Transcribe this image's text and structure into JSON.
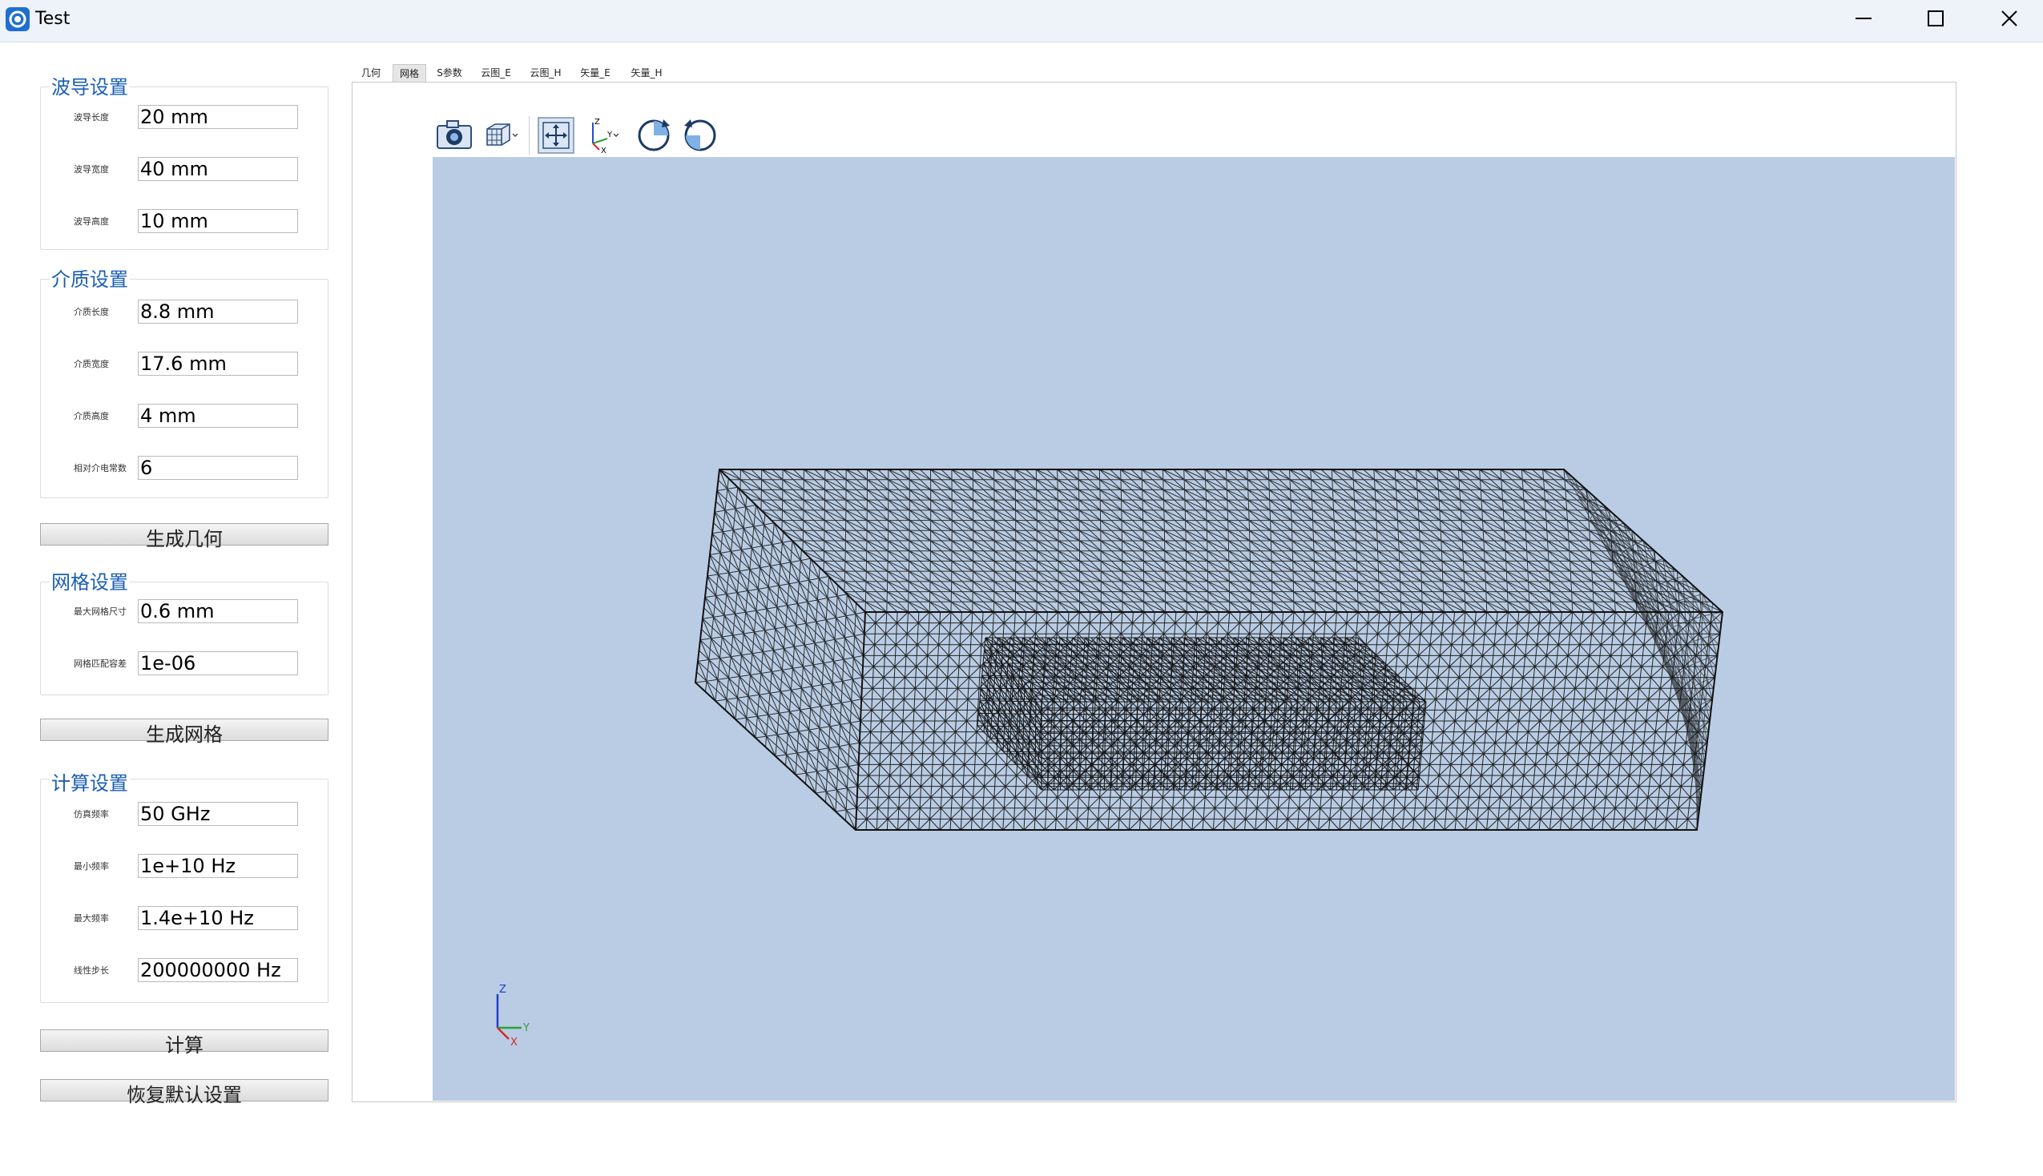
{
  "window": {
    "title": "Test",
    "icon": "app-swirl-icon",
    "controls": [
      "minimize-icon",
      "maximize-icon",
      "close-icon"
    ]
  },
  "left_panel": {
    "waveguide": {
      "title": "波导设置",
      "fields": [
        {
          "label": "波导长度",
          "value": "20 mm"
        },
        {
          "label": "波导宽度",
          "value": "40 mm"
        },
        {
          "label": "波导高度",
          "value": "10 mm"
        }
      ]
    },
    "dielectric": {
      "title": "介质设置",
      "fields": [
        {
          "label": "介质长度",
          "value": "8.8 mm"
        },
        {
          "label": "介质宽度",
          "value": "17.6 mm"
        },
        {
          "label": "介质高度",
          "value": "4 mm"
        },
        {
          "label": "相对介电常数",
          "value": "6"
        }
      ]
    },
    "generate_geometry_button": "生成几何",
    "mesh": {
      "title": "网格设置",
      "fields": [
        {
          "label": "最大网格尺寸",
          "value": "0.6 mm"
        },
        {
          "label": "网格匹配容差",
          "value": "1e-06"
        }
      ]
    },
    "generate_mesh_button": "生成网格",
    "compute": {
      "title": "计算设置",
      "fields": [
        {
          "label": "仿真频率",
          "value": "50 GHz"
        },
        {
          "label": "最小频率",
          "value": "1e+10 Hz"
        },
        {
          "label": "最大频率",
          "value": "1.4e+10 Hz"
        },
        {
          "label": "线性步长",
          "value": "200000000 Hz"
        }
      ]
    },
    "compute_button": "计算",
    "reset_button": "恢复默认设置"
  },
  "tabs": [
    {
      "label": "几何",
      "active": false
    },
    {
      "label": "网格",
      "active": true
    },
    {
      "label": "S参数",
      "active": false
    },
    {
      "label": "云图_E",
      "active": false
    },
    {
      "label": "云图_H",
      "active": false
    },
    {
      "label": "矢量_E",
      "active": false
    },
    {
      "label": "矢量_H",
      "active": false
    }
  ],
  "viewer": {
    "toolbar": [
      "camera-icon",
      "view-cube-icon",
      "fit-all-icon",
      "axes-orientation-icon",
      "rotate-cw-icon",
      "rotate-ccw-icon"
    ],
    "background_color": "#b9cce3",
    "axis_labels": {
      "z": "Z",
      "y": "Y",
      "x": "X"
    }
  },
  "colors": {
    "accent": "#1a5fb4",
    "mesh_line": "#111111"
  }
}
